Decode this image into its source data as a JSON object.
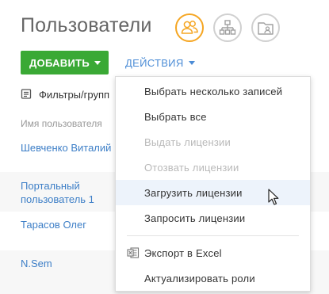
{
  "header": {
    "title": "Пользователи"
  },
  "toolbar": {
    "add_label": "ДОБАВИТЬ",
    "actions_label": "ДЕЙСТВИЯ",
    "filters_label": "Фильтры/групп"
  },
  "table": {
    "column_header": "Имя пользователя",
    "rows": [
      {
        "name": "Шевченко Виталий"
      },
      {
        "name": "Портальный пользователь 1"
      },
      {
        "name": "Тарасов Олег"
      },
      {
        "name": "N.Sem"
      }
    ]
  },
  "actions_menu": {
    "items": [
      {
        "label": "Выбрать несколько записей",
        "enabled": true
      },
      {
        "label": "Выбрать все",
        "enabled": true
      },
      {
        "label": "Выдать лицензии",
        "enabled": false
      },
      {
        "label": "Отозвать лицензии",
        "enabled": false
      },
      {
        "label": "Загрузить лицензии",
        "enabled": true,
        "hovered": true
      },
      {
        "label": "Запросить лицензии",
        "enabled": true
      },
      {
        "label": "Экспорт в Excel",
        "enabled": true,
        "icon": "excel-icon"
      },
      {
        "label": "Актуализировать роли",
        "enabled": true
      }
    ]
  },
  "colors": {
    "accent_orange": "#f5a623",
    "add_button": "#3aa935",
    "link_blue": "#3e7fc7",
    "disabled_text": "#b9b9b9",
    "hover_bg": "#edf3fb"
  }
}
